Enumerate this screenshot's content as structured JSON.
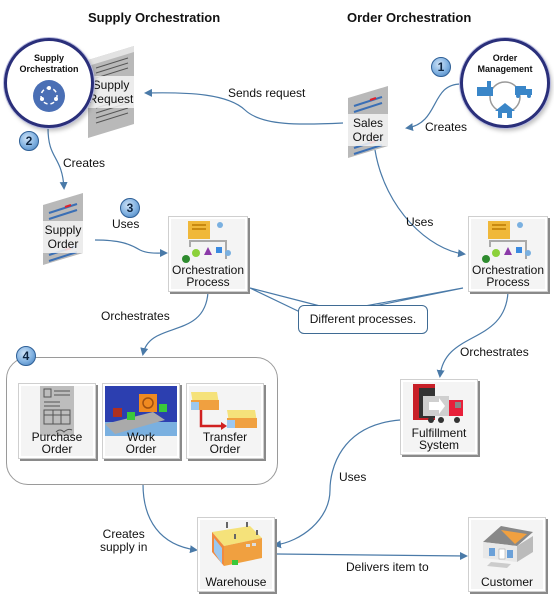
{
  "headings": {
    "supply": "Supply Orchestration",
    "order": "Order Orchestration"
  },
  "nodes": {
    "supply_orchestration": {
      "title_line1": "Supply",
      "title_line2": "Orchestration",
      "icon": "cycle-icon"
    },
    "order_management": {
      "title_line1": "Order",
      "title_line2": "Management",
      "icon": "factory-truck-home-icon"
    },
    "supply_request": {
      "line1": "Supply",
      "line2": "Request"
    },
    "sales_order": {
      "line1": "Sales",
      "line2": "Order"
    },
    "supply_order": {
      "line1": "Supply",
      "line2": "Order"
    },
    "orchestration_process_left": {
      "line1": "Orchestration",
      "line2": "Process"
    },
    "orchestration_process_right": {
      "line1": "Orchestration",
      "line2": "Process"
    },
    "purchase_order": {
      "line1": "Purchase",
      "line2": "Order"
    },
    "work_order": {
      "line1": "Work",
      "line2": "Order"
    },
    "transfer_order": {
      "line1": "Transfer",
      "line2": "Order"
    },
    "fulfillment_system": {
      "line1": "Fulfillment",
      "line2": "System"
    },
    "warehouse": {
      "label": "Warehouse"
    },
    "customer": {
      "label": "Customer"
    }
  },
  "badges": {
    "b1": "1",
    "b2": "2",
    "b3": "3",
    "b4": "4"
  },
  "edge_labels": {
    "sends_request": "Sends request",
    "creates_sales": "Creates",
    "creates_supply": "Creates",
    "uses_left": "Uses",
    "uses_right": "Uses",
    "orchestrates_left": "Orchestrates",
    "orchestrates_right": "Orchestrates",
    "uses_fulfillment": "Uses",
    "creates_supply_in_line1": "Creates",
    "creates_supply_in_line2": "supply in",
    "delivers": "Delivers  item to"
  },
  "callout": {
    "text": "Different  processes."
  },
  "colors": {
    "connector": "#4a7aa8",
    "circle_border": "#2a2f7a",
    "icon_blue": "#4a6fb5"
  }
}
